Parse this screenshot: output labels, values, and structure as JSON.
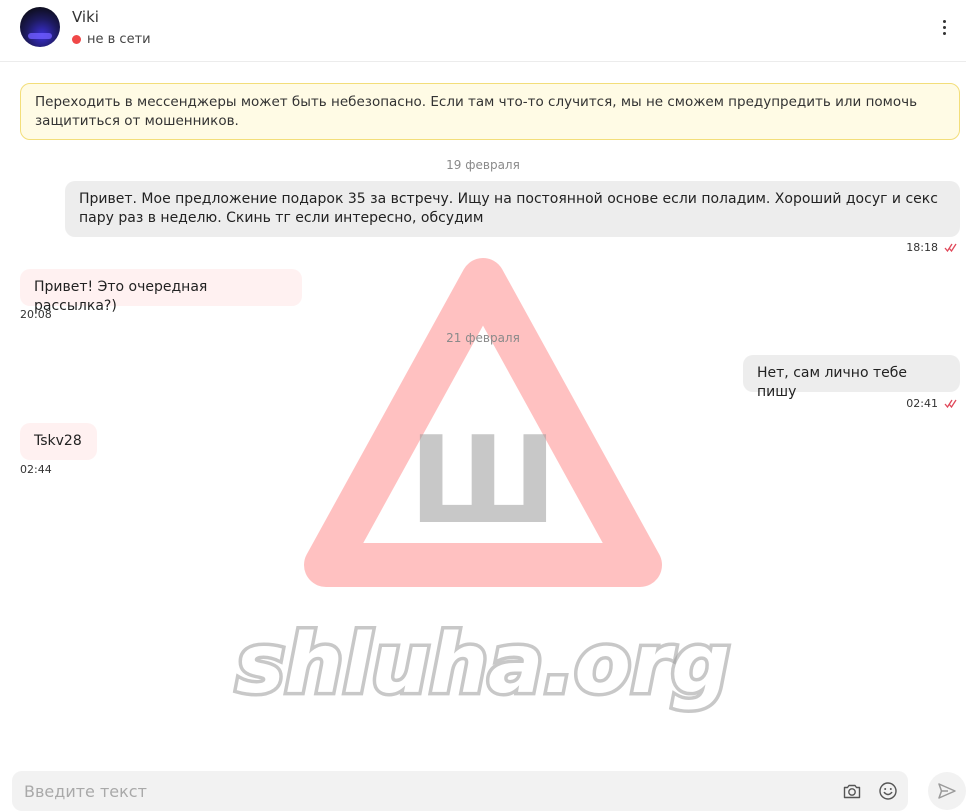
{
  "header": {
    "contact_name": "Viki",
    "status_text": "не в сети",
    "status_color": "#f04848",
    "menu_icon": "kebab-menu-icon"
  },
  "watermark": {
    "sign_letter": "Ш",
    "site_text": "shluha.org",
    "triangle_color": "#ff6b6b"
  },
  "warning": {
    "text": "Переходить в мессенджеры может быть небезопасно. Если там что-то случится, мы не сможем предупредить или помочь защититься от мошенников."
  },
  "messages": [
    {
      "date_separator": "19 февраля"
    },
    {
      "direction": "out",
      "text": "Привет. Мое предложение подарок 35 за встречу. Ищу на постоянной основе если поладим. Хороший досуг и секс пару раз в неделю. Скинь тг если интересно, обсудим",
      "time": "18:18",
      "read": true
    },
    {
      "direction": "in",
      "text": "Привет! Это очередная рассылка?)",
      "time": "20:08"
    },
    {
      "date_separator": "21 февраля"
    },
    {
      "direction": "out",
      "text": "Нет, сам лично тебе пишу",
      "time": "02:41",
      "read": true
    },
    {
      "direction": "in",
      "text": "Tskv28",
      "time": "02:44"
    }
  ],
  "composer": {
    "placeholder": "Введите текст",
    "value": "",
    "camera_icon": "camera-icon",
    "emoji_icon": "emoji-icon",
    "send_icon": "send-icon"
  },
  "colors": {
    "read_check": "#e0485a",
    "incoming_bubble": "#fff0f0",
    "outgoing_bubble": "#ececec",
    "warning_bg": "#fffbe5",
    "warning_border": "#f3de7a"
  }
}
